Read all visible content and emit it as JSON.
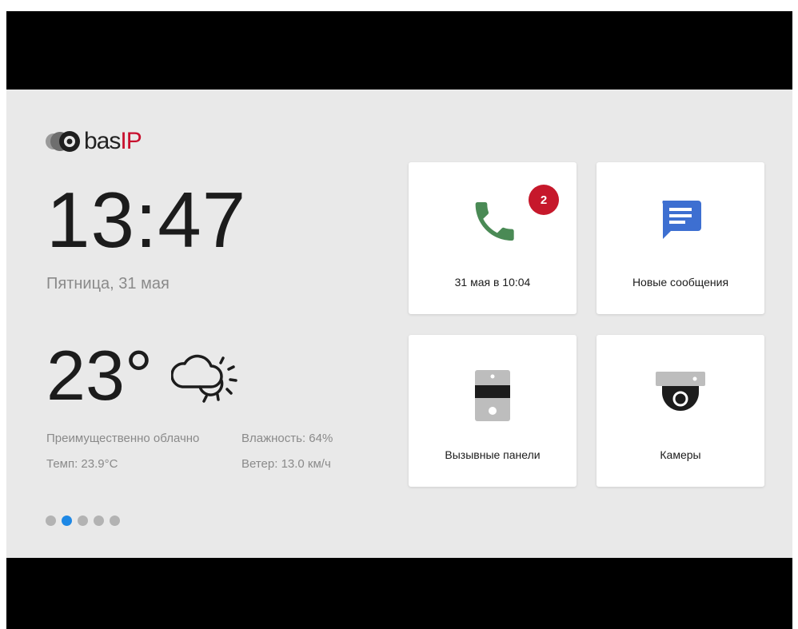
{
  "brand": {
    "logo_text_bas": "bas",
    "logo_text_ip": "IP"
  },
  "clock": {
    "time": "13:47",
    "date": "Пятница, 31 мая"
  },
  "weather": {
    "temperature": "23°",
    "condition": "Преимущественно облачно",
    "temp_detail": "Темп: 23.9°C",
    "humidity": "Влажность: 64%",
    "wind": "Ветер: 13.0 км/ч",
    "icon": "partly-cloudy-icon"
  },
  "pager": {
    "total": 5,
    "active_index": 1
  },
  "tiles": [
    {
      "label": "31 мая в 10:04",
      "icon": "phone-icon",
      "badge": "2",
      "icon_color": "#4a8a55"
    },
    {
      "label": "Новые сообщения",
      "icon": "message-icon",
      "icon_color": "#3d6fd1"
    },
    {
      "label": "Вызывные панели",
      "icon": "door-panel-icon"
    },
    {
      "label": "Камеры",
      "icon": "camera-icon"
    }
  ],
  "colors": {
    "accent": "#1e88e5",
    "badge": "#c6182b",
    "brand_ip": "#c8102e"
  }
}
